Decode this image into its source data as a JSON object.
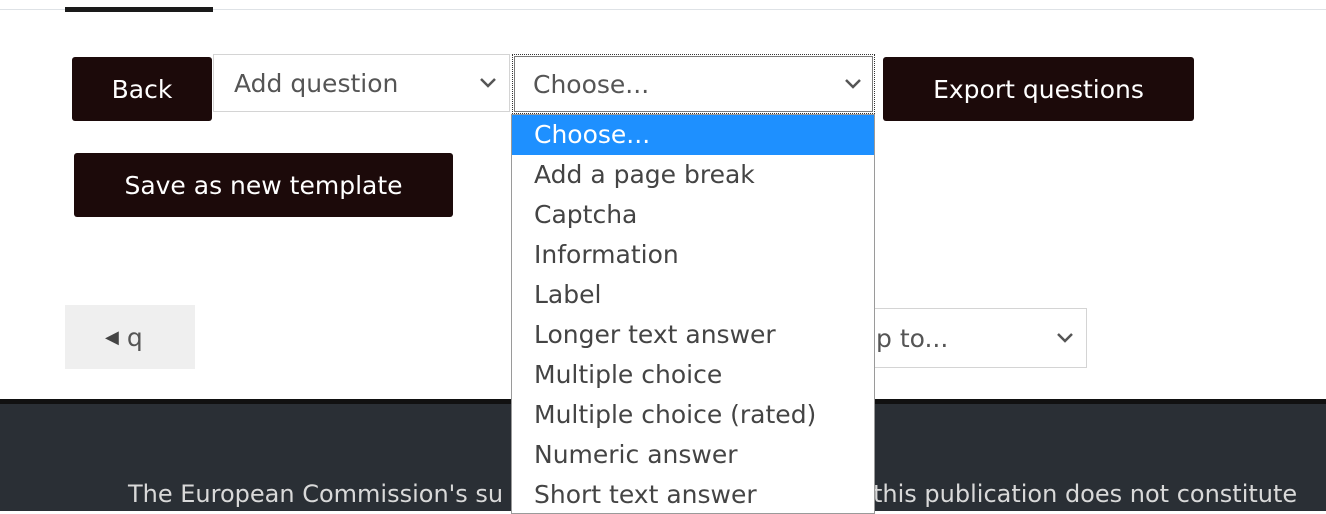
{
  "toolbar": {
    "back_label": "Back",
    "add_question_value": "Add question",
    "choose_value": "Choose...",
    "export_label": "Export questions",
    "save_template_label": "Save as new template"
  },
  "pager": {
    "prev_label": "q"
  },
  "jump": {
    "value": "p to..."
  },
  "dropdown": {
    "options": [
      "Choose...",
      "Add a page break",
      "Captcha",
      "Information",
      "Label",
      "Longer text answer",
      "Multiple choice",
      "Multiple choice (rated)",
      "Numeric answer",
      "Short text answer"
    ],
    "selected_index": 0
  },
  "footer": {
    "text": "The European Commission's su",
    "text_right": "this publication does not constitute"
  },
  "colors": {
    "dark_button": "#1c0a0a",
    "selected_option": "#1e90ff",
    "footer_bg": "#2a2f35"
  },
  "icons": {
    "chevron": "chevron-down-icon",
    "prev": "triangle-left-icon"
  }
}
